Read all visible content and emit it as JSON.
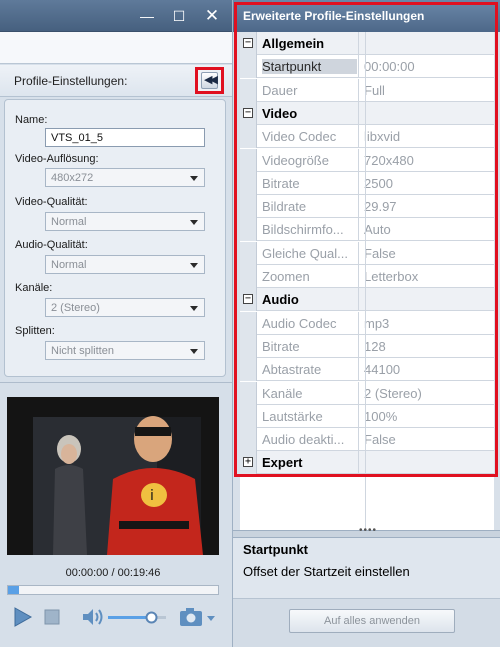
{
  "left": {
    "window_controls": {
      "minimize": "—",
      "maximize": "☐",
      "close": "✕"
    },
    "profile_settings_label": "Profile-Einstellungen:",
    "collapse_icon": "◀◀",
    "fields": {
      "name": {
        "label": "Name:",
        "value": "VTS_01_5"
      },
      "video_resolution": {
        "label": "Video-Auflösung:",
        "value": "480x272"
      },
      "video_quality": {
        "label": "Video-Qualität:",
        "value": "Normal"
      },
      "audio_quality": {
        "label": "Audio-Qualität:",
        "value": "Normal"
      },
      "channels": {
        "label": "Kanäle:",
        "value": "2 (Stereo)"
      },
      "split": {
        "label": "Splitten:",
        "value": "Nicht splitten"
      }
    },
    "player": {
      "time": "00:00:00 / 00:19:46",
      "progress": 0.05,
      "volume": 0.75
    }
  },
  "right": {
    "title": "Erweiterte Profile-Einstellungen",
    "rows": [
      {
        "type": "cat",
        "key": "Allgemein",
        "toggle": "−"
      },
      {
        "type": "prop",
        "key": "Startpunkt",
        "value": "00:00:00",
        "selected": true
      },
      {
        "type": "prop",
        "key": "Dauer",
        "value": "Full"
      },
      {
        "type": "cat",
        "key": "Video",
        "toggle": "−"
      },
      {
        "type": "prop",
        "key": "Video Codec",
        "value": "libxvid"
      },
      {
        "type": "prop",
        "key": "Videogröße",
        "value": "720x480"
      },
      {
        "type": "prop",
        "key": "Bitrate",
        "value": "2500"
      },
      {
        "type": "prop",
        "key": "Bildrate",
        "value": "29.97"
      },
      {
        "type": "prop",
        "key": "Bildschirmfo...",
        "value": "Auto"
      },
      {
        "type": "prop",
        "key": "Gleiche Qual...",
        "value": "False"
      },
      {
        "type": "prop",
        "key": "Zoomen",
        "value": "Letterbox"
      },
      {
        "type": "cat",
        "key": "Audio",
        "toggle": "−"
      },
      {
        "type": "prop",
        "key": "Audio Codec",
        "value": "mp3"
      },
      {
        "type": "prop",
        "key": "Bitrate",
        "value": "128"
      },
      {
        "type": "prop",
        "key": "Abtastrate",
        "value": "44100"
      },
      {
        "type": "prop",
        "key": "Kanäle",
        "value": "2 (Stereo)"
      },
      {
        "type": "prop",
        "key": "Lautstärke",
        "value": "100%"
      },
      {
        "type": "prop",
        "key": "Audio deakti...",
        "value": "False"
      },
      {
        "type": "cat",
        "key": "Expert",
        "toggle": "+"
      }
    ],
    "description": {
      "title": "Startpunkt",
      "text": "Offset der Startzeit einstellen"
    },
    "apply_button": "Auf alles anwenden"
  }
}
